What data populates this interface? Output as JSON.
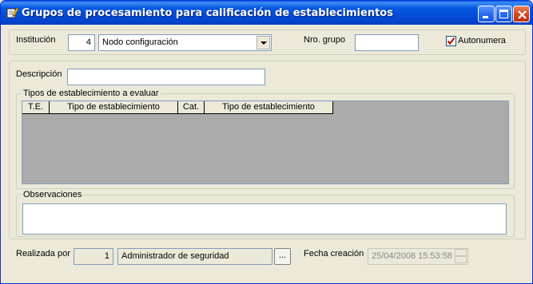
{
  "window": {
    "title": "Grupos de procesamiento para calificación de establecimientos"
  },
  "header": {
    "institucion_label": "Institución",
    "institucion_id": "4",
    "institucion_name": "Nodo configuración",
    "nro_grupo_label": "Nro. grupo",
    "nro_grupo_value": "",
    "autonumera_label": "Autonumera",
    "autonumera_checked": true
  },
  "form": {
    "descripcion_label": "Descripción",
    "descripcion_value": "",
    "tipos_group_title": "Tipos de establecimiento a evaluar",
    "grid_columns": [
      "T.E.",
      "Tipo de establecimiento",
      "Cat.",
      "Tipo de establecimiento"
    ],
    "observaciones_title": "Observaciones",
    "observaciones_value": ""
  },
  "footer": {
    "realizada_por_label": "Realizada por",
    "user_id": "1",
    "user_name": "Administrador de seguridad",
    "browse_label": "...",
    "fecha_creacion_label": "Fecha creación",
    "fecha_creacion_value": "25/04/2008 15:53:58"
  },
  "colors": {
    "titlebar": "#0558e0",
    "window_bg": "#ece9d8",
    "grid_bg": "#ababab",
    "checkmark": "#c00000"
  },
  "icons": {
    "title": "edit-pencil-icon",
    "minimize": "minimize-icon",
    "maximize": "maximize-icon",
    "close": "close-icon",
    "combo": "chevron-down-icon",
    "spinner": "spinner-arrows-icon"
  }
}
